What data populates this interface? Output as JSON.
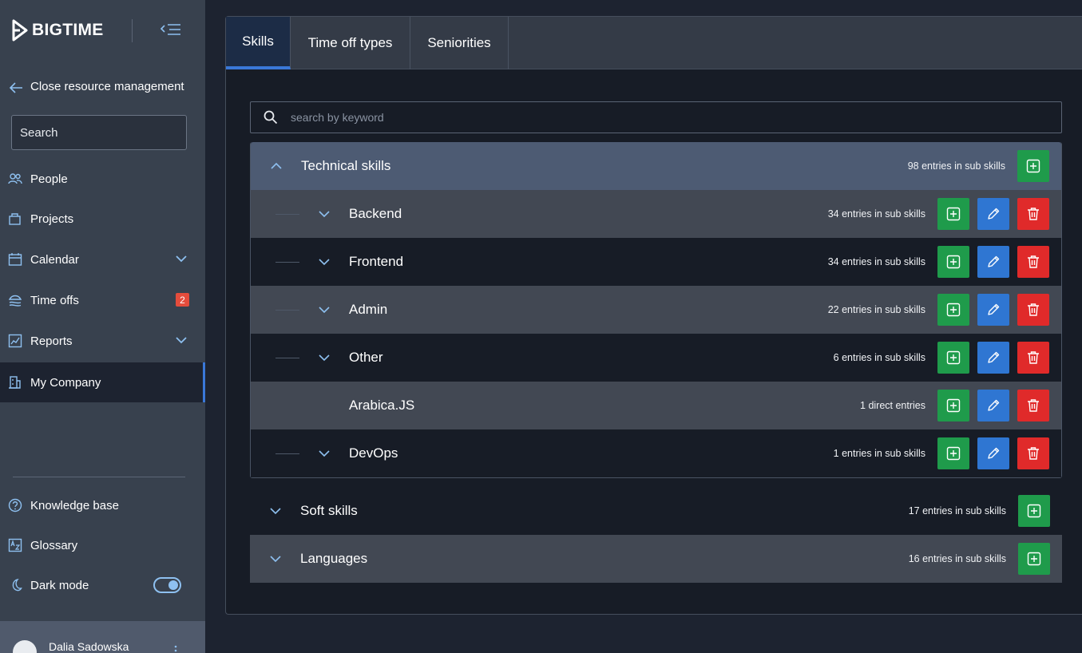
{
  "app": {
    "logo_text": "BIGTIME"
  },
  "sidebar": {
    "back_label": "Close resource management",
    "search_placeholder": "Search",
    "items": [
      {
        "label": "People",
        "icon": "people-icon"
      },
      {
        "label": "Projects",
        "icon": "projects-icon"
      },
      {
        "label": "Calendar",
        "icon": "calendar-icon"
      },
      {
        "label": "Time offs",
        "icon": "time-offs-icon",
        "badge": "2"
      },
      {
        "label": "Reports",
        "icon": "reports-icon"
      },
      {
        "label": "My Company",
        "icon": "company-icon",
        "active": true
      }
    ],
    "bottom": [
      {
        "label": "Knowledge base",
        "icon": "help-circle-icon"
      },
      {
        "label": "Glossary",
        "icon": "glossary-icon"
      },
      {
        "label": "Dark mode",
        "icon": "moon-icon",
        "toggle": true
      }
    ],
    "user": {
      "name": "Dalia Sadowska"
    }
  },
  "tabs": [
    {
      "label": "Skills",
      "active": true
    },
    {
      "label": "Time off types"
    },
    {
      "label": "Seniorities"
    }
  ],
  "keyword_search": {
    "placeholder": "search by keyword"
  },
  "tree": {
    "technical": {
      "label": "Technical skills",
      "count": "98 entries in sub skills",
      "children": [
        {
          "label": "Backend",
          "count": "34 entries in sub skills"
        },
        {
          "label": "Frontend",
          "count": "34 entries in sub skills"
        },
        {
          "label": "Admin",
          "count": "22 entries in sub skills"
        },
        {
          "label": "Other",
          "count": "6 entries in sub skills"
        },
        {
          "label": "Arabica.JS",
          "count": "1 direct entries"
        },
        {
          "label": "DevOps",
          "count": "1 entries in sub skills"
        }
      ]
    },
    "soft": {
      "label": "Soft skills",
      "count": "17 entries in sub skills"
    },
    "languages": {
      "label": "Languages",
      "count": "16 entries in sub skills"
    }
  },
  "colors": {
    "accent": "#3a78d8",
    "add": "#1f9b4b",
    "edit": "#2f76d2",
    "delete": "#e02a2a",
    "badge": "#e44c3c"
  }
}
